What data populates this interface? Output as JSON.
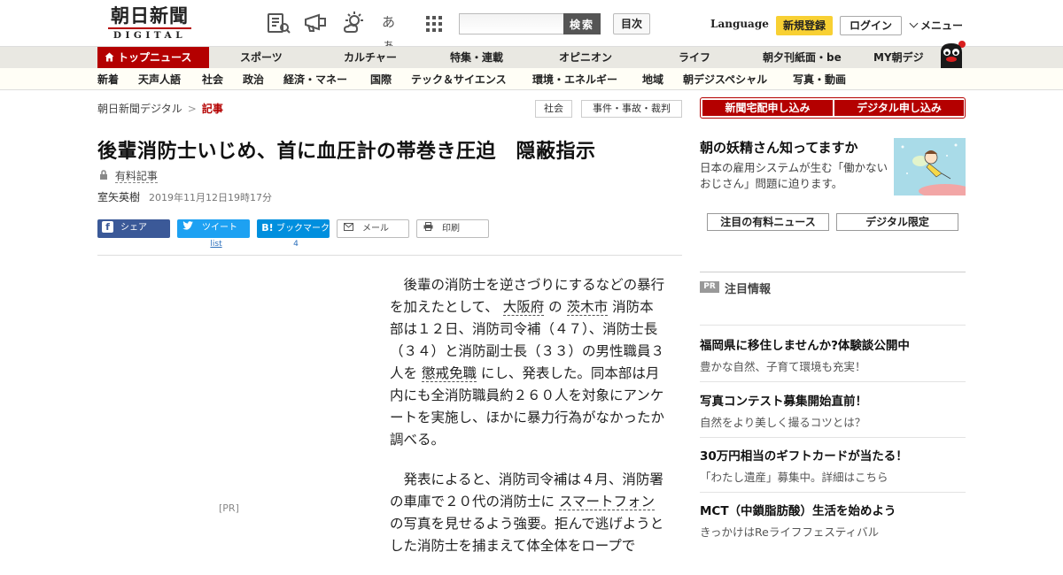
{
  "header": {
    "logo_ja": "朝日新聞",
    "logo_en": "DIGITAL",
    "char_size_label": "あぁ",
    "search_button": "検索",
    "search_placeholder": "",
    "toc_button": "目次",
    "language": "Language",
    "register": "新規登録",
    "login": "ログイン",
    "menu": "メニュー"
  },
  "nav_primary": [
    "トップニュース",
    "スポーツ",
    "カルチャー",
    "特集・連載",
    "オピニオン",
    "ライフ",
    "朝夕刊紙面・be",
    "MY朝デジ"
  ],
  "nav_secondary": [
    "新着",
    "天声人語",
    "社会",
    "政治",
    "経済・マネー",
    "国際",
    "テック＆サイエンス",
    "環境・エネルギー",
    "地域",
    "朝デジスペシャル",
    "写真・動画"
  ],
  "breadcrumb": {
    "site": "朝日新聞デジタル",
    "sep": ">",
    "current": "記事"
  },
  "tags": [
    "社会",
    "事件・事故・裁判"
  ],
  "article": {
    "title": "後輩消防士いじめ、首に血圧計の帯巻き圧迫　隠蔽指示",
    "paid_label": "有料記事",
    "author": "室矢英樹",
    "date": "2019年11月12日19時17分",
    "share": {
      "facebook": "シェア",
      "twitter": "ツイート",
      "hatena": "ブックマーク",
      "mail": "メール",
      "print": "印刷",
      "twitter_count": "list",
      "hatena_count": "4"
    },
    "pr_label": "[PR]",
    "p1": {
      "a": "後輩の消防士を逆さづりにするなどの暴行を加えたとして、",
      "link1": "大阪府",
      "b": "の",
      "link2": "茨木市",
      "c": "消防本部は１２日、消防司令補（４７）、消防士長（３４）と消防副士長（３３）の男性職員３人を",
      "link3": "懲戒免職",
      "d": "にし、発表した。同本部は月内にも全消防職員約２６０人を対象にアンケートを実施し、ほかに暴力行為がなかったか調べる。"
    },
    "p2": {
      "a": "発表によると、消防司令補は４月、消防署の車庫で２０代の消防士に",
      "link1": "スマートフォン",
      "b": "の写真を見せるよう強要。拒んで逃げようとした消防士を捕まえて体全体をロープで"
    }
  },
  "sidebar": {
    "subscribe_newspaper": "新聞宅配申し込み",
    "subscribe_digital": "デジタル申し込み",
    "promo_title": "朝の妖精さん知ってますか",
    "promo_desc": "日本の雇用システムが生む「働かないおじさん」問題に迫ります。",
    "tab_paid_news": "注目の有料ニュース",
    "tab_digital_only": "デジタル限定",
    "pr_badge": "PR",
    "pr_heading": "注目情報",
    "pr_items": [
      {
        "title": "福岡県に移住しませんか?体験談公開中",
        "desc": "豊かな自然、子育て環境も充実！"
      },
      {
        "title": "写真コンテスト募集開始直前！",
        "desc": "自然をより美しく撮るコツとは？"
      },
      {
        "title": "30万円相当のギフトカードが当たる！",
        "desc": "「わたし遺産」募集中。詳細はこちら"
      },
      {
        "title": "MCT（中鎖脂肪酸）生活を始めよう",
        "desc": "きっかけはReライフフェスティバル"
      }
    ]
  },
  "colors": {
    "brand_red": "#b40000",
    "register_yellow": "#f8d033",
    "facebook": "#3b5998",
    "twitter": "#1da1f2",
    "hatena": "#008fde"
  }
}
